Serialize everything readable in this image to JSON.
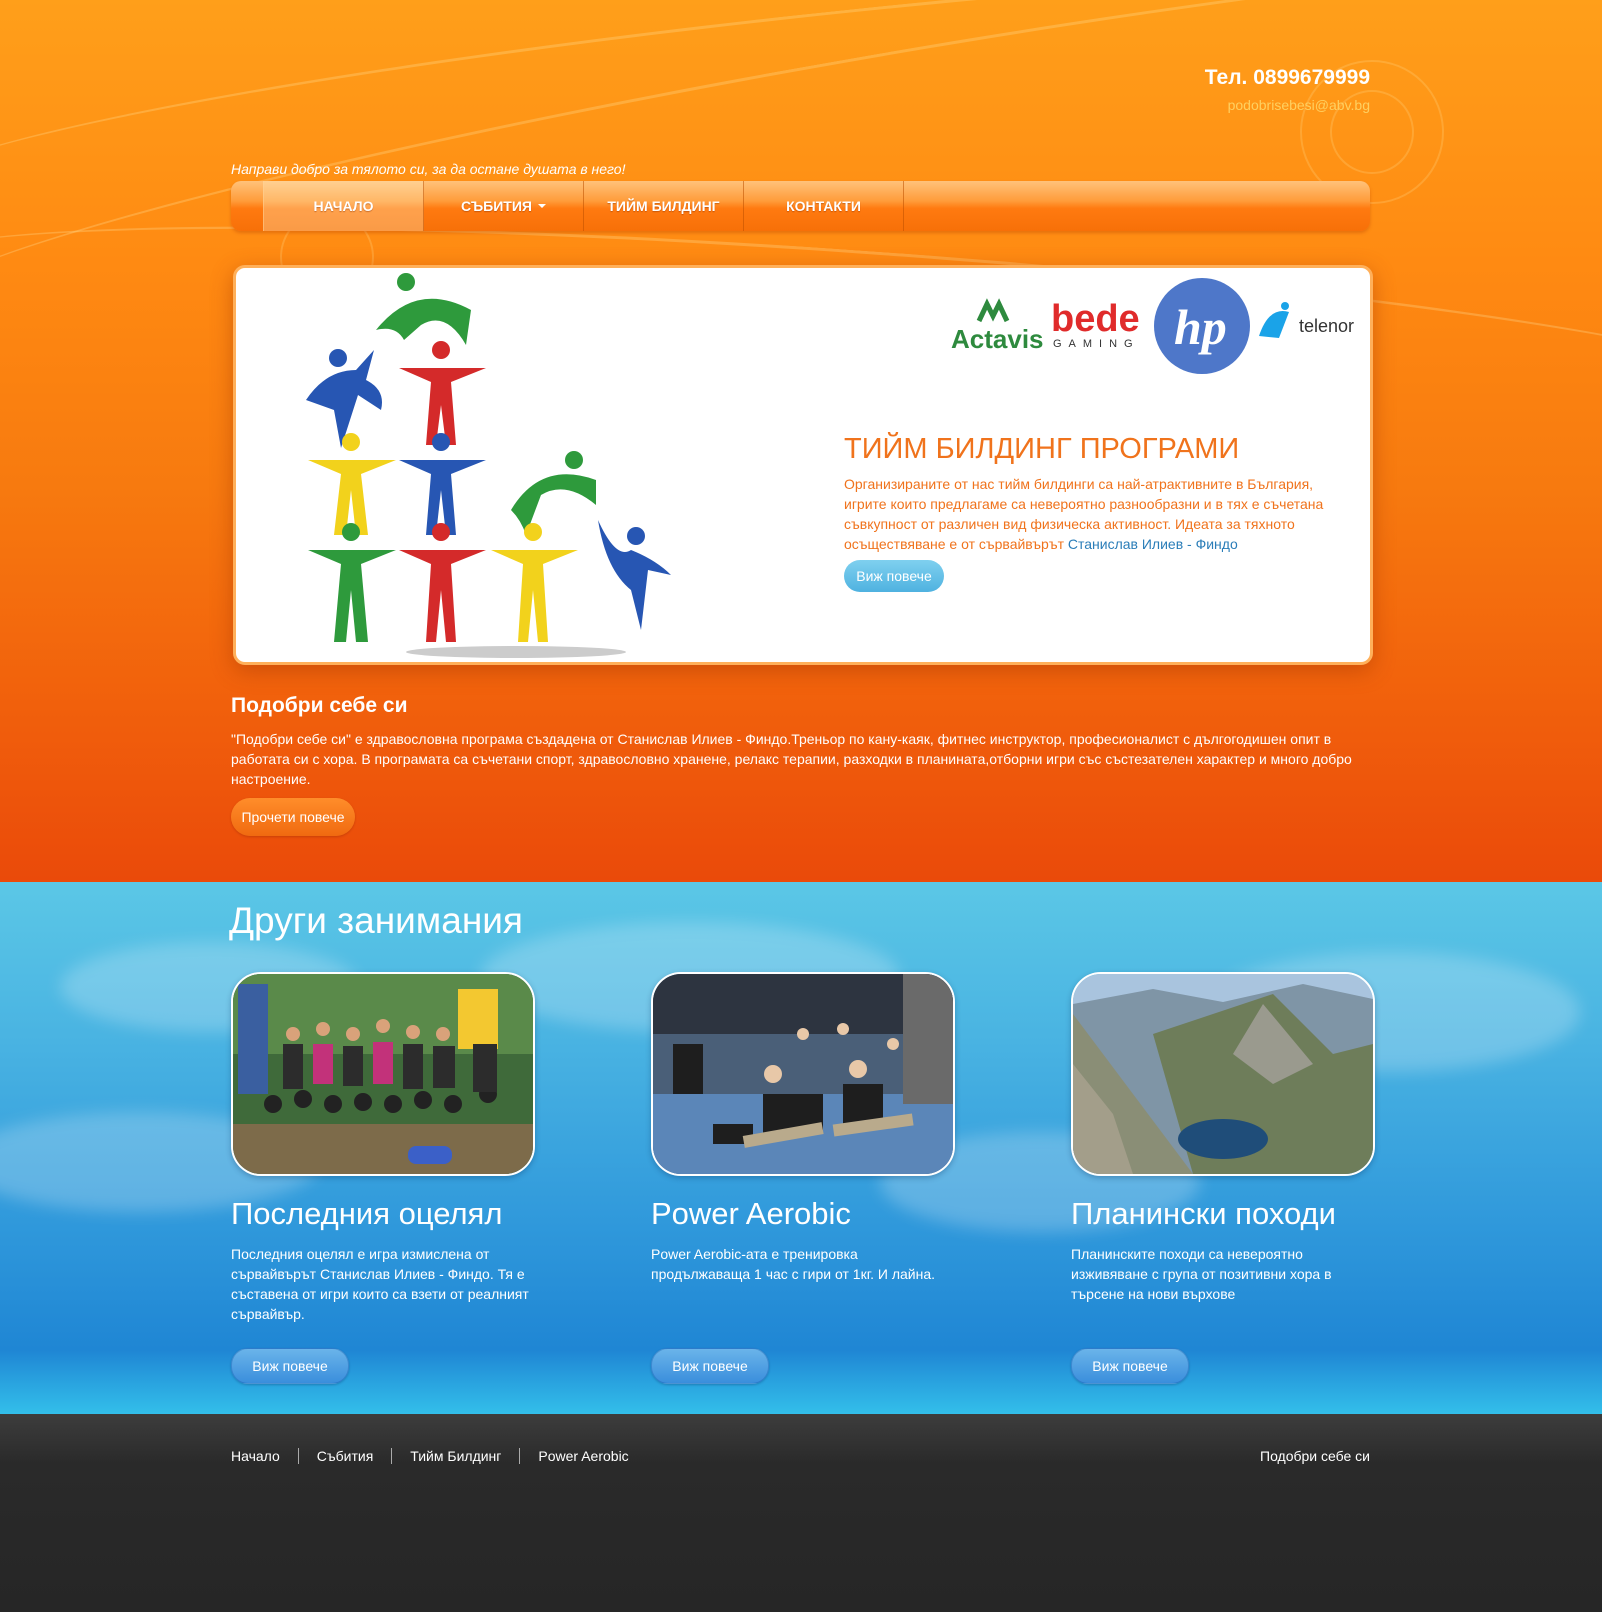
{
  "header": {
    "phone": "Тел. 0899679999",
    "email": "podobrisebesi@abv.bg",
    "tagline": "Направи добро за тялото си, за да остане душата в него!"
  },
  "nav": {
    "items": [
      {
        "label": "НАЧАЛО"
      },
      {
        "label": "СЪБИТИЯ"
      },
      {
        "label": "ТИЙМ БИЛДИНГ"
      },
      {
        "label": "КОНТАКТИ"
      }
    ]
  },
  "hero": {
    "title": "ТИЙМ БИЛДИНГ ПРОГРАМИ",
    "text": "Организираните от нас тийм билдинги са най-атрактивните в България, игрите които предлагаме са невероятно разнообразни и в тях е съчетана съвкупност от различен вид физическа активност. Идеата за тяхното осъществяване е от сървайвърът ",
    "link": "Станислав Илиев - Финдо",
    "button": "Виж повече",
    "logos": {
      "actavis": "Actavis",
      "bede": "bede",
      "gaming": "GAMING",
      "hp": "hp",
      "telenor": "telenor"
    }
  },
  "intro": {
    "title": "Подобри себе си",
    "text": "\"Подобри себе си\" е здравословна програма създадена от Станислав Илиев - Финдо.Треньор по кану-каяк, фитнес инструктор, професионалист с дългогодишен опит в работата си с хора. В програмата са съчетани спорт, здравословно хранене, релакс терапии, разходки в планината,отборни игри със състезателен характер и много добро настроение.",
    "button": "Прочети повече"
  },
  "activities": {
    "title": "Други занимания",
    "cards": [
      {
        "title": "Последния оцелял",
        "text": "Последния оцелял е игра измислена от сървайвърът Станислав Илиев - Финдо. Тя е съставена от игри които са взети от реалният сървайвър.",
        "button": "Виж повече"
      },
      {
        "title": "Power Aerobic",
        "text": "Power Aerobic-ата е тренировка продължаваща 1 час с гири от 1кг. И лайна.",
        "button": "Виж повече"
      },
      {
        "title": "Планински походи",
        "text": "Планинските походи са невероятно изживяване с група от позитивни хора в търсене на нови върхове",
        "button": "Виж повече"
      }
    ]
  },
  "footer": {
    "links": [
      "Начало",
      "Събития",
      "Тийм Билдинг",
      "Power Aerobic"
    ],
    "right": "Подобри себе си"
  }
}
